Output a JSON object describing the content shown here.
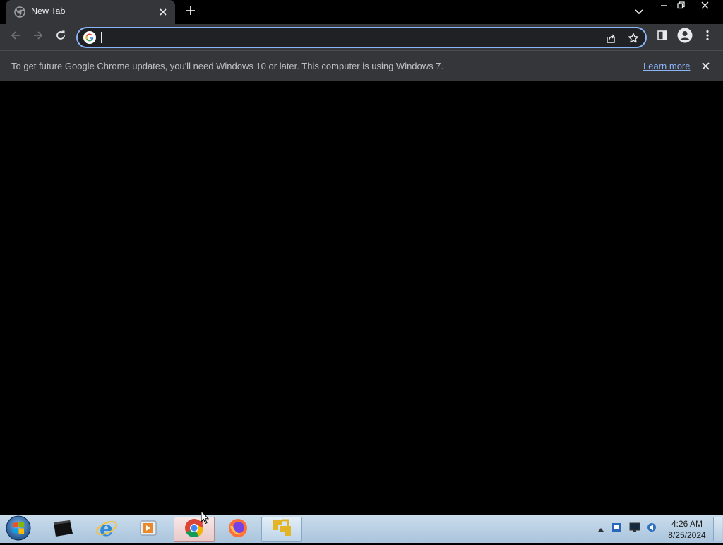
{
  "browser": {
    "tab": {
      "title": "New Tab",
      "close_label": "×"
    },
    "new_tab_label": "+",
    "window_controls": {
      "minimize": "minimize",
      "restore": "restore",
      "close": "close"
    }
  },
  "toolbar": {
    "omnibox": {
      "value": "",
      "placeholder": ""
    },
    "icons": [
      "back-icon",
      "forward-icon",
      "reload-icon",
      "google-icon",
      "share-icon",
      "bookmark-star-icon",
      "side-panel-icon",
      "profile-icon",
      "menu-icon"
    ]
  },
  "infobar": {
    "message": "To get future Google Chrome updates, you'll need Windows 10 or later. This computer is using Windows 7.",
    "link": "Learn more"
  },
  "taskbar": {
    "apps": [
      "windows-start",
      "cmd",
      "internet-explorer",
      "media-player",
      "chrome",
      "firefox",
      "network-app"
    ],
    "clock": {
      "time": "4:26 AM",
      "date": "8/25/2024"
    }
  },
  "colors": {
    "accent": "#8ab4f8",
    "toolbar": "#35363a",
    "page": "#000000"
  }
}
